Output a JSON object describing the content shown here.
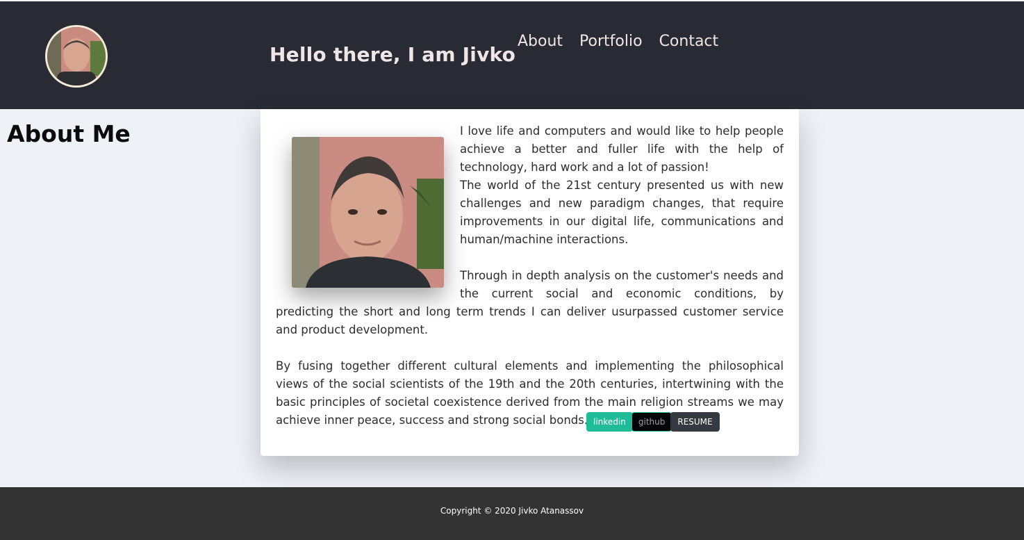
{
  "header": {
    "headline": "Hello there, I am Jivko",
    "nav": [
      {
        "label": "About"
      },
      {
        "label": "Portfolio"
      },
      {
        "label": "Contact"
      }
    ]
  },
  "about": {
    "title": "About Me",
    "paragraph_1a": "I love life and computers and would like to help people achieve a better and fuller life with the help of technology, hard work and a lot of passion!",
    "paragraph_1b": "The world of the 21st century presented us with new challenges and new paradigm changes, that require improvements in our digital life, communications and human/machine interactions.",
    "paragraph_2": "Through in depth analysis on the customer's needs and the current social and economic conditions, by predicting the short and long term trends I can deliver usurpassed customer service and product development.",
    "paragraph_3": "By fusing together different cultural elements and implementing the philosophical views of the social scientists of the 19th and the 20th centuries, intertwining with the basic principles of societal coexistence derived from the main religion streams we may achieve inner peace, success and strong social bonds.",
    "buttons": {
      "linkedin": "linkedin",
      "github": "github",
      "resume": "RESUME"
    }
  },
  "footer": {
    "copyright": "Copyright © 2020 Jivko Atanassov"
  },
  "colors": {
    "header_bg": "#282b33",
    "page_bg": "#eef1f6",
    "linkedin": "#1fbc97",
    "github": "#050607",
    "resume": "#343a40",
    "footer_bg": "#333333"
  }
}
